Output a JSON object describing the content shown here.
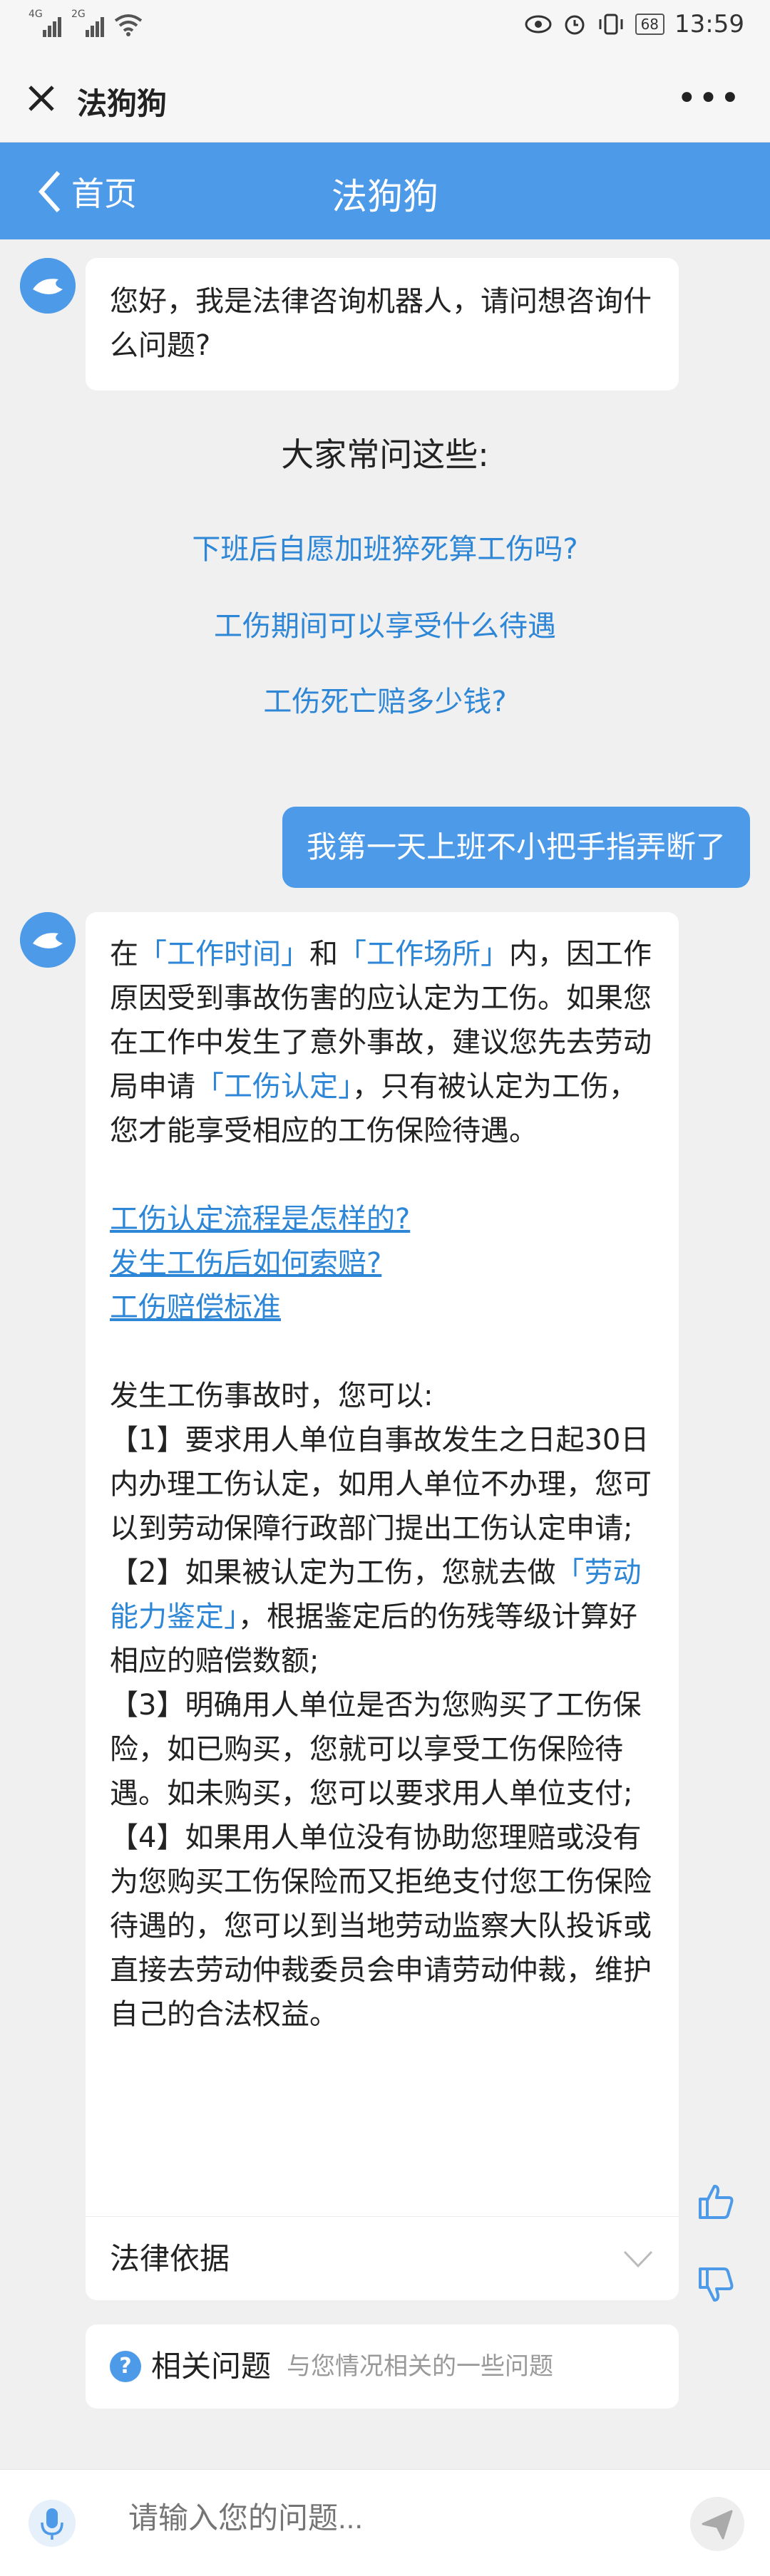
{
  "status_bar": {
    "net1": "4G",
    "net2": "2G",
    "battery": "68",
    "time": "13:59"
  },
  "app_bar": {
    "title": "法狗狗"
  },
  "nav_bar": {
    "back_label": "首页",
    "title": "法狗狗"
  },
  "greeting": {
    "text": "您好，我是法律咨询机器人，请问想咨询什么问题?"
  },
  "faq": {
    "heading": "大家常问这些:",
    "items": [
      "下班后自愿加班猝死算工伤吗?",
      "工伤期间可以享受什么待遇",
      "工伤死亡赔多少钱?"
    ]
  },
  "user_message": {
    "text": "我第一天上班不小把手指弄断了"
  },
  "answer": {
    "intro_1": "在",
    "hl_1": "「工作时间」",
    "intro_2": "和",
    "hl_2": "「工作场所」",
    "intro_3": "内，因工作原因受到事故伤害的应认定为工伤。如果您在工作中发生了意外事故，建议您先去劳动局申请",
    "hl_3": "「工伤认定」",
    "intro_4": "，只有被认定为工伤，您才能享受相应的工伤保险待遇。",
    "links": [
      "工伤认定流程是怎样的?",
      "发生工伤后如何索赔?",
      "工伤赔偿标准"
    ],
    "steps_title": "发生工伤事故时，您可以:",
    "step1": "【1】要求用人单位自事故发生之日起30日内办理工伤认定，如用人单位不办理，您可以到劳动保障行政部门提出工伤认定申请;",
    "step2_a": "【2】如果被认定为工伤，您就去做",
    "step2_hl": "「劳动能力鉴定」",
    "step2_b": "，根据鉴定后的伤残等级计算好相应的赔偿数额;",
    "step3": "【3】明确用人单位是否为您购买了工伤保险，如已购买，您就可以享受工伤保险待遇。如未购买，您可以要求用人单位支付;",
    "step4": "【4】如果用人单位没有协助您理赔或没有为您购买工伤保险而又拒绝支付您工伤保险待遇的，您可以到当地劳动监察大队投诉或直接去劳动仲裁委员会申请劳动仲裁，维护自己的合法权益。",
    "legal_basis": "法律依据"
  },
  "related": {
    "title": "相关问题",
    "subtitle": "与您情况相关的一些问题"
  },
  "input": {
    "placeholder": "请输入您的问题..."
  },
  "colors": {
    "brand": "#4d9ae8",
    "link": "#2d86d6"
  }
}
